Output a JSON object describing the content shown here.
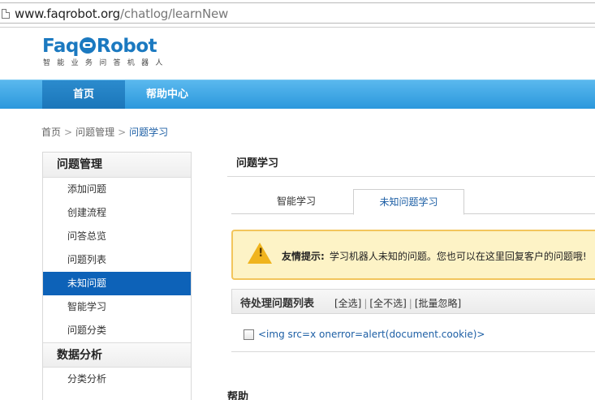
{
  "browser": {
    "url_domain": "www.faqrobot.org",
    "url_path": "/chatlog/learnNew"
  },
  "logo": {
    "text_left": "Faq",
    "text_right": "Robot",
    "subtitle": "智能业务问答机器人"
  },
  "nav": {
    "items": [
      {
        "label": "首页"
      },
      {
        "label": "帮助中心"
      }
    ]
  },
  "breadcrumb": {
    "items": [
      "首页",
      "问题管理",
      "问题学习"
    ],
    "separator": ">"
  },
  "sidebar": {
    "section1_title": "问题管理",
    "section1_items": [
      "添加问题",
      "创建流程",
      "问答总览",
      "问题列表",
      "未知问题",
      "智能学习",
      "问题分类"
    ],
    "active_item": "未知问题",
    "section2_title": "数据分析",
    "section2_items": [
      "分类分析"
    ]
  },
  "main": {
    "title": "问题学习",
    "tabs": [
      {
        "label": "智能学习"
      },
      {
        "label": "未知问题学习"
      }
    ],
    "warning": {
      "label": "友情提示:",
      "text": "学习机器人未知的问题。您也可以在这里回复客户的问题哦!"
    },
    "pending": {
      "title": "待处理问题列表",
      "select_all": "[全选]",
      "select_none": "[全不选]",
      "batch_ignore": "[批量忽略]",
      "bar": "|"
    },
    "questions": [
      {
        "text": "<img src=x onerror=alert(document.cookie)>"
      }
    ],
    "help_title": "帮助"
  },
  "colors": {
    "nav_blue": "#2b98dc",
    "active_blue": "#0d62b8",
    "link_blue": "#1d5fa5",
    "warning_bg": "#fdf3c6",
    "warning_border": "#f2c55c"
  }
}
